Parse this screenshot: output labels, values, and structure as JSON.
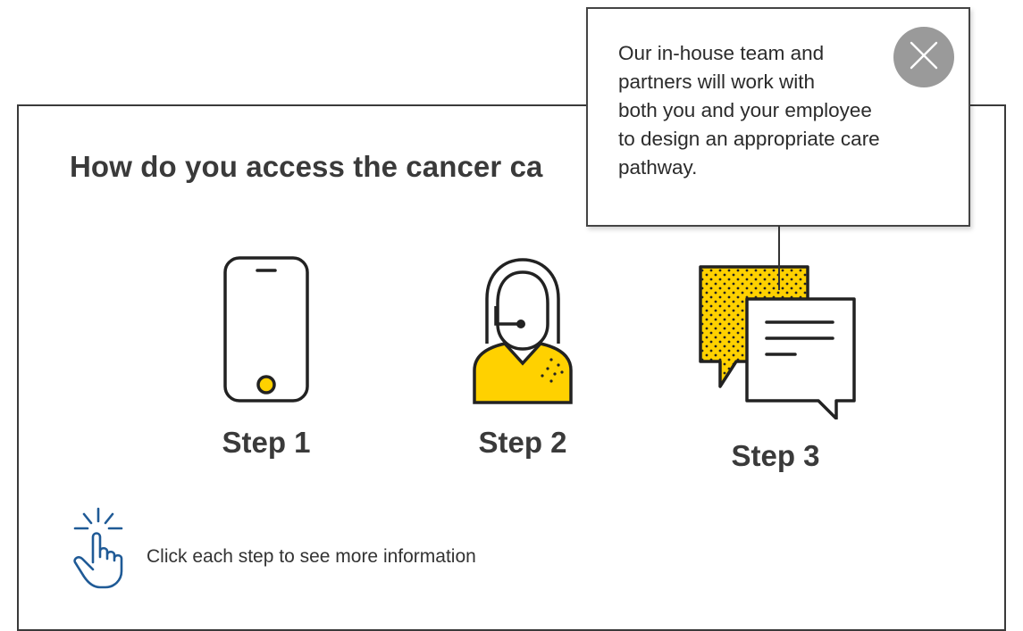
{
  "heading": "How do you access the cancer ca",
  "steps": [
    {
      "label": "Step 1",
      "icon": "smartphone-icon"
    },
    {
      "label": "Step 2",
      "icon": "support-agent-icon"
    },
    {
      "label": "Step 3",
      "icon": "chat-bubbles-icon"
    }
  ],
  "hint": {
    "icon": "tap-hand-icon",
    "text": "Click each step to see more information"
  },
  "tooltip": {
    "text": "Our in-house team and\npartners will work with\nboth you and your employee\nto design an appropriate care\npathway.",
    "close_icon": "close-icon"
  },
  "colors": {
    "accent_yellow": "#FFD100",
    "hint_blue": "#1F5A96",
    "close_grey": "#9A9A9A",
    "border": "#3A3A3A"
  }
}
